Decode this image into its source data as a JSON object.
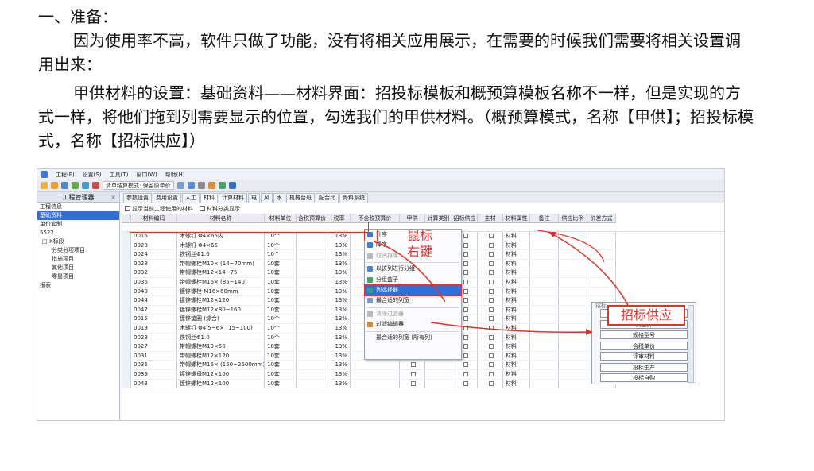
{
  "doc": {
    "heading": "一、准备：",
    "para1": "因为使用率不高，软件只做了功能，没有将相关应用展示，在需要的时候我们需要将相关设置调用出来：",
    "para2": "甲供材料的设置：基础资料——材料界面：招投标模板和概预算模板名称不一样，但是实现的方式一样，将他们拖到列需要显示的位置，勾选我们的甲供材料。（概预算模式，名称【甲供】；招投标模式，名称【招标供应】）"
  },
  "screenshot": {
    "menu": [
      "工程(P)",
      "设置(S)",
      "工具(T)",
      "窗口(W)",
      "帮助(H)"
    ],
    "toolbar_mode": "清单结算模式: 保留原单价",
    "left_panel": {
      "title": "工程管理器",
      "items": [
        "工程信息",
        "基础资料",
        "单价套制",
        "5522",
        "X标段",
        "分类分项项目",
        "措施项目",
        "其他项目",
        "零星项目",
        "报表"
      ],
      "selected": "基础资料"
    },
    "tabs": [
      "参数设置",
      "费用设置",
      "人工",
      "材料",
      "计算材料",
      "电",
      "风",
      "水",
      "机械台班",
      "配合比",
      "骨料系统"
    ],
    "active_tab": "材料",
    "options": [
      "显示当前工程使用的材料",
      "材料分类显示"
    ],
    "columns": [
      "材料编码",
      "材料名称",
      "材料单位",
      "含税预算价",
      "税率",
      "不含税预算价",
      "甲供",
      "计算类别",
      "招标供应",
      "主材",
      "材料属性",
      "备注",
      "供应比例",
      "价差方式"
    ],
    "rows": [
      {
        "code": "0016",
        "name": "木螺钉 Φ4×65内",
        "unit": "10个",
        "tax": "13%",
        "prop": "材料"
      },
      {
        "code": "0020",
        "name": "木螺钉 Φ4×65",
        "unit": "10个",
        "tax": "13%",
        "prop": "材料"
      },
      {
        "code": "0024",
        "name": "铁钢丝Φ1.6",
        "unit": "10个",
        "tax": "13%",
        "prop": "材料"
      },
      {
        "code": "0028",
        "name": "带帽螺栓M10× (14~70mm)",
        "unit": "10套",
        "tax": "13%",
        "prop": "材料"
      },
      {
        "code": "0032",
        "name": "带帽螺栓M12×14~75",
        "unit": "10套",
        "tax": "13%",
        "prop": "材料"
      },
      {
        "code": "0036",
        "name": "带帽螺栓M16× (85~140)",
        "unit": "10套",
        "tax": "13%",
        "prop": "材料"
      },
      {
        "code": "0040",
        "name": "镀锌螺栓 M16×60mm",
        "unit": "10套",
        "tax": "13%",
        "prop": "材料"
      },
      {
        "code": "0044",
        "name": "镀锌螺栓M12×120",
        "unit": "10套",
        "tax": "13%",
        "prop": "材料"
      },
      {
        "code": "0047",
        "name": "镀锌螺栓M12×80~160",
        "unit": "10套",
        "tax": "13%",
        "prop": "材料"
      },
      {
        "code": "0015",
        "name": "镀锌垫圈 (综合)",
        "unit": "10个",
        "tax": "13%",
        "prop": "材料"
      },
      {
        "code": "0019",
        "name": "木螺钉 Φ4.5~6× (15~100)",
        "unit": "10个",
        "tax": "13%",
        "prop": "材料"
      },
      {
        "code": "0023",
        "name": "铁钢丝Φ1.0",
        "unit": "10个",
        "tax": "13%",
        "prop": "材料"
      },
      {
        "code": "0027",
        "name": "带帽螺栓M10×50",
        "unit": "10套",
        "tax": "13%",
        "prop": "材料"
      },
      {
        "code": "0031",
        "name": "带帽螺栓M12×120",
        "unit": "10套",
        "tax": "13%",
        "prop": "材料"
      },
      {
        "code": "0035",
        "name": "带帽螺栓M16× (150~2500mm)",
        "unit": "10套",
        "tax": "13%",
        "prop": "材料"
      },
      {
        "code": "0039",
        "name": "镀锌螺母M12×100",
        "unit": "10套",
        "tax": "13%",
        "prop": "材料"
      },
      {
        "code": "0043",
        "name": "镀锌螺栓M12×100",
        "unit": "10套",
        "tax": "13%",
        "prop": "材料"
      }
    ],
    "context_menu": [
      "升序",
      "降序",
      "取消排序",
      "以该列进行分组",
      "分组盒子",
      "列选择器",
      "最合适的列宽",
      "清除过滤器",
      "过滤编辑器",
      "最合适的列宽 (所有列)"
    ],
    "context_menu_highlight": "列选择器",
    "chooser_items": [
      "定额价",
      "供应价",
      "规格型号",
      "含税单价",
      "评审材料",
      "投标生产",
      "投标自购"
    ],
    "chooser_label": "招标",
    "annotation_right_click": "鼠标右键",
    "annotation_bid_supply": "招标供应"
  }
}
